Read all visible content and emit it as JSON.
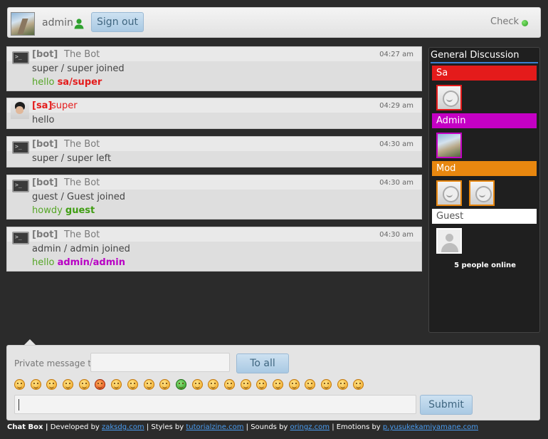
{
  "header": {
    "username": "admin",
    "sign_out_label": "Sign out",
    "check_label": "Check",
    "status_color": "#3cb72c"
  },
  "messages": [
    {
      "role": "[bot]",
      "name": "The Bot",
      "time": "04:27 am",
      "line1": "super / super joined",
      "line2_prefix": "hello",
      "line2_highlight": "sa/super",
      "avatar": "terminal-icon"
    },
    {
      "role": "[sa]",
      "name": "super",
      "time": "04:29 am",
      "line1": "hello",
      "avatar": "user-photo"
    },
    {
      "role": "[bot]",
      "name": "The Bot",
      "time": "04:30 am",
      "line1": "super / super left",
      "avatar": "terminal-icon"
    },
    {
      "role": "[bot]",
      "name": "The Bot",
      "time": "04:30 am",
      "line1": "guest / Guest joined",
      "line2_prefix": "howdy",
      "line2_highlight": "guest",
      "avatar": "terminal-icon"
    },
    {
      "role": "[bot]",
      "name": "The Bot",
      "time": "04:30 am",
      "line1": "admin / admin joined",
      "line2_prefix": "hello",
      "line2_highlight": "admin/admin",
      "avatar": "terminal-icon"
    }
  ],
  "sidebar": {
    "title": "General Discussion",
    "groups": [
      {
        "label": "Sa",
        "color": "#e41b1b"
      },
      {
        "label": "Admin",
        "color": "#c400c4"
      },
      {
        "label": "Mod",
        "color": "#e8870f"
      },
      {
        "label": "Guest",
        "color": "#ffffff"
      }
    ],
    "online_text": "5 people online"
  },
  "composer": {
    "private_label": "Private message to",
    "private_value": "",
    "to_all_label": "To all",
    "message_value": "",
    "submit_label": "Submit",
    "emoticon_count": 22
  },
  "footer": {
    "brand": "Chat Box |",
    "dev_prefix": " Developed by ",
    "dev_link": "zaksdg.com",
    "styles_prefix": " | Styles by ",
    "styles_link": "tutorialzine.com",
    "sounds_prefix": " | Sounds by ",
    "sounds_link": "oringz.com",
    "emotions_prefix": " | Emotions by ",
    "emotions_link": "p.yusukekamiyamane.com"
  }
}
